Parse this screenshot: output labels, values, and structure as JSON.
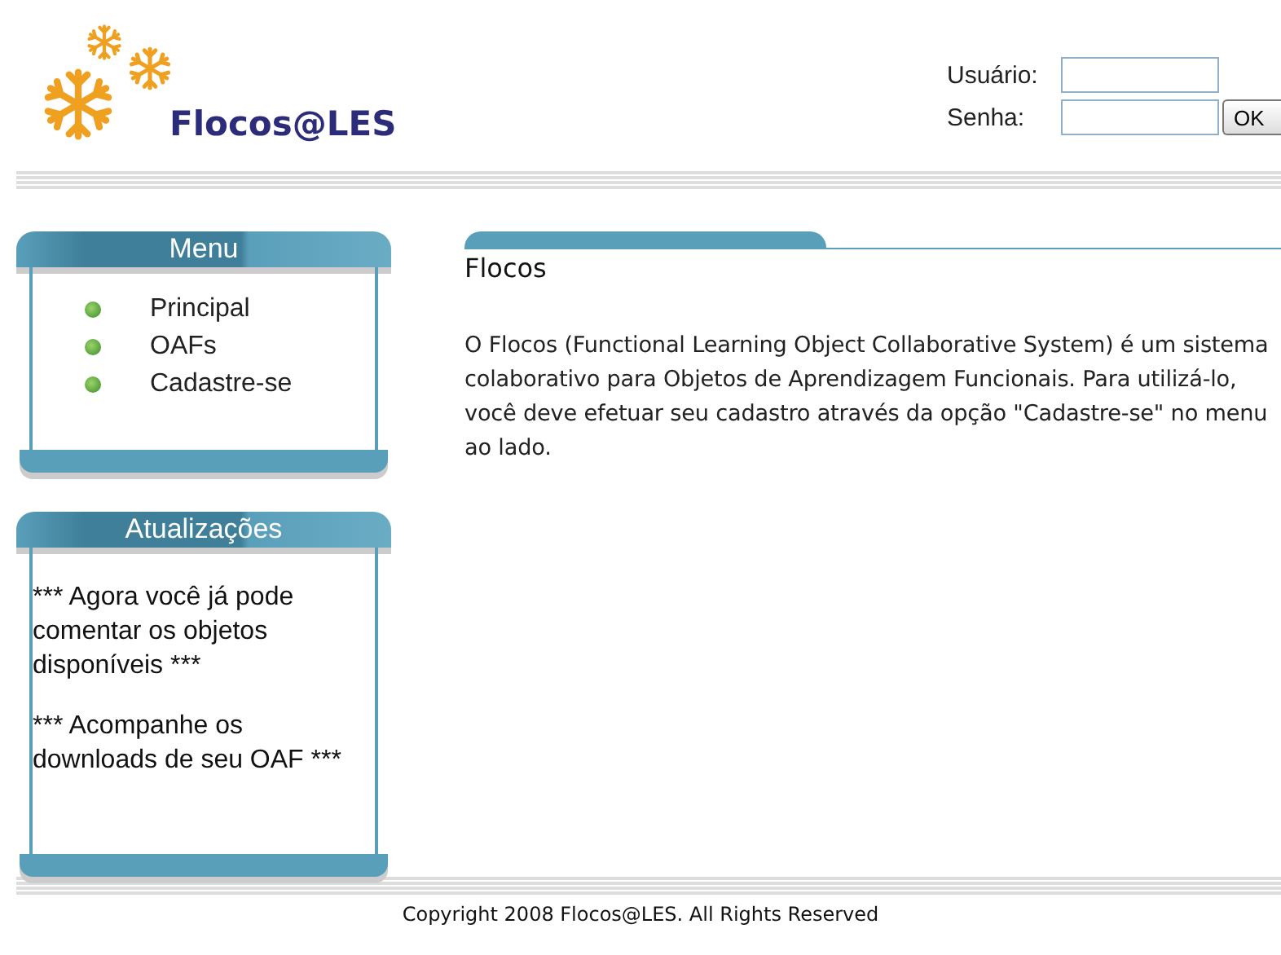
{
  "logo": {
    "text": "Flocos@LES"
  },
  "login": {
    "user_label": "Usuário:",
    "password_label": "Senha:",
    "submit": "OK"
  },
  "menu": {
    "title": "Menu",
    "items": [
      {
        "label": "Principal"
      },
      {
        "label": "OAFs"
      },
      {
        "label": "Cadastre-se"
      }
    ]
  },
  "updates": {
    "title": "Atualizações",
    "items": [
      "*** Agora você já pode comentar os objetos disponíveis ***",
      "*** Acompanhe os downloads de seu OAF ***"
    ]
  },
  "content": {
    "title": "Flocos",
    "body": "O Flocos (Functional Learning Object Collaborative System) é um sistema colaborativo para Objetos de Aprendizagem Funcionais. Para utilizá-lo, você deve efetuar seu cadastro através da opção \"Cadastre-se\" no menu ao lado."
  },
  "footer": "Copyright 2008 Flocos@LES. All Rights Reserved"
}
